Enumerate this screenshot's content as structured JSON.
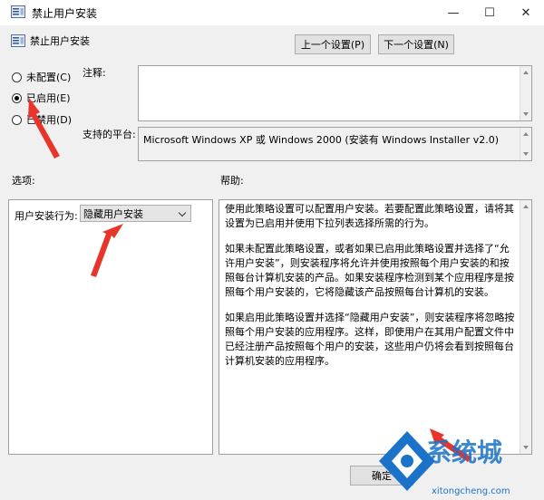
{
  "window": {
    "title": "禁止用户安装",
    "minimize_glyph": "—",
    "maximize_glyph": "☐",
    "close_glyph": "✕"
  },
  "header": {
    "policy_name": "禁止用户安装",
    "prev_button": "上一个设置(P)",
    "next_button": "下一个设置(N)"
  },
  "state": {
    "options": [
      {
        "label": "未配置(C)",
        "selected": false
      },
      {
        "label": "已启用(E)",
        "selected": true
      },
      {
        "label": "已禁用(D)",
        "selected": false
      }
    ]
  },
  "comment": {
    "label": "注释:",
    "value": ""
  },
  "platform": {
    "label": "支持的平台:",
    "value": "Microsoft Windows XP 或 Windows 2000 (安装有 Windows Installer v2.0)"
  },
  "options_panel": {
    "label": "选项:",
    "field_label": "用户安装行为:",
    "select_value": "隐藏用户安装"
  },
  "help_panel": {
    "label": "帮助:",
    "paragraphs": [
      "使用此策略设置可以配置用户安装。若要配置此策略设置，请将其设置为已启用并使用下拉列表选择所需的行为。",
      "如果未配置此策略设置，或者如果已启用此策略设置并选择了“允许用户安装”，则安装程序将允许并使用按照每个用户安装的和按照每台计算机安装的产品。如果安装程序检测到某个应用程序是按照每个用户安装的，它将隐藏该产品按照每台计算机的安装。",
      "如果启用此策略设置并选择“隐藏用户安装”，则安装程序将忽略按照每个用户安装的应用程序。这样，即使用户在其用户配置文件中已经注册产品按照每个用户的安装，这些用户仍将会看到按照每台计算机安装的应用程序。"
    ]
  },
  "footer": {
    "ok_button": "确定"
  },
  "watermark": {
    "brand": "系统城",
    "domain": "xitongcheng.com"
  },
  "colors": {
    "arrow": "#e8352b",
    "watermark_blue": "#1a73c8"
  }
}
